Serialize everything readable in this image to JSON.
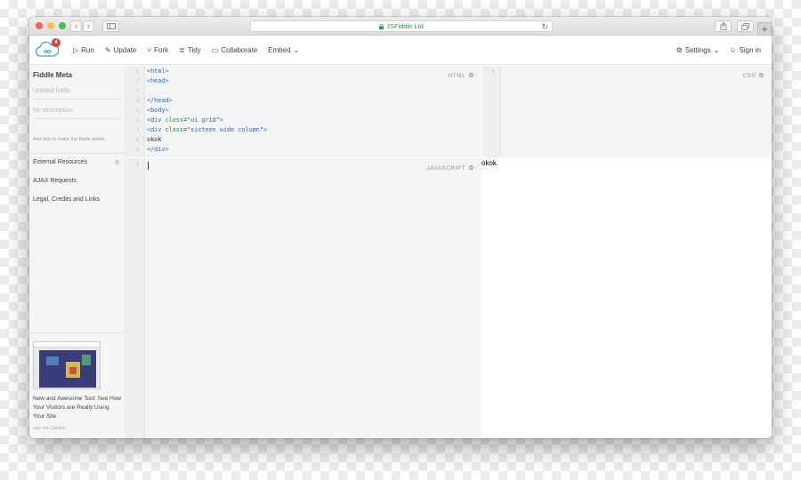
{
  "browser": {
    "address": "JSFiddle Ltd",
    "lock_icon": "lock-icon",
    "traffic_lights": [
      "#fc605b",
      "#fdbc40",
      "#34c84a"
    ],
    "back_icon": "chevron-left-icon",
    "forward_icon": "chevron-right-icon",
    "sidebar_icon": "sidebar-icon",
    "reload_icon": "reload-icon",
    "share_icon": "share-icon",
    "tabs_icon": "tabs-icon",
    "new_tab_label": "+"
  },
  "header": {
    "notification_count": "4",
    "actions": [
      {
        "icon": "play-icon",
        "label": "Run"
      },
      {
        "icon": "pencil-icon",
        "label": "Update"
      },
      {
        "icon": "fork-icon",
        "label": "Fork"
      },
      {
        "icon": "tidy-icon",
        "label": "Tidy"
      },
      {
        "icon": "chat-icon",
        "label": "Collaborate"
      },
      {
        "icon": "chevron-down-icon",
        "label": "Embed"
      }
    ],
    "settings_label": "Settings",
    "signin_label": "Sign in"
  },
  "sidebar": {
    "title": "Fiddle Meta",
    "title_placeholder": "Untitled fiddle",
    "description_placeholder": "No description",
    "hint": "Add title to make the fiddle public.",
    "links": [
      {
        "label": "External Resources",
        "count": "2"
      },
      {
        "label": "AJAX Requests"
      },
      {
        "label": "Legal, Credits and Links"
      }
    ],
    "ad": {
      "text": "New and Awesome Tool: See How Your Visitors are Really Using Your Site",
      "via": "ads via Carbon"
    }
  },
  "editors": {
    "html": {
      "label": "HTML",
      "line_numbers": [
        "1",
        "2",
        "3",
        "4",
        "5",
        "6",
        "7",
        "8",
        "9"
      ],
      "lines": [
        {
          "tag_open": "<html>"
        },
        {
          "tag_open": "<head>"
        },
        {
          "text": ""
        },
        {
          "tag_open": "</head>"
        },
        {
          "tag_open": "<body>"
        },
        {
          "pre": "<div ",
          "attr": "class",
          "eq": "=",
          "str": "\"ui grid\"",
          "post": ">"
        },
        {
          "pre": "<div ",
          "attr": "class",
          "eq": "=",
          "str": "\"sixteen wide column\"",
          "post": ">"
        },
        {
          "text": "okok"
        },
        {
          "tag_open": "</div>"
        }
      ]
    },
    "css": {
      "label": "CSS",
      "line_numbers": [
        "1"
      ]
    },
    "javascript": {
      "label": "JAVASCRIPT",
      "line_numbers": [
        "1"
      ]
    }
  },
  "result": {
    "text": "okok"
  }
}
